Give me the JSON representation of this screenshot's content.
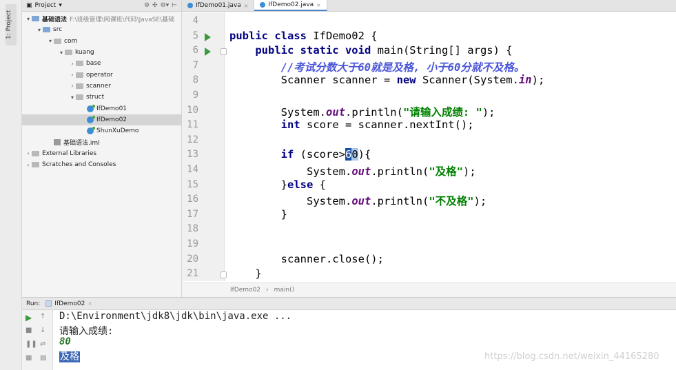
{
  "toolstrip": {
    "project_tab": "1: Project"
  },
  "project_panel": {
    "header_label": "Project",
    "header_icons": [
      "⚙",
      "✣",
      "⚙▾",
      "⊢"
    ],
    "tree": [
      {
        "label": "基础语法",
        "path": "F:\\班级管理\\网课班\\代码\\JavaSE\\基础",
        "indent": 0,
        "arrow": "▾",
        "icon": "folder-blue",
        "bold": true
      },
      {
        "label": "src",
        "indent": 1,
        "arrow": "▾",
        "icon": "folder-blue"
      },
      {
        "label": "com",
        "indent": 2,
        "arrow": "▾",
        "icon": "folder"
      },
      {
        "label": "kuang",
        "indent": 3,
        "arrow": "▾",
        "icon": "folder"
      },
      {
        "label": "base",
        "indent": 4,
        "arrow": "›",
        "icon": "folder"
      },
      {
        "label": "operator",
        "indent": 4,
        "arrow": "›",
        "icon": "folder"
      },
      {
        "label": "scanner",
        "indent": 4,
        "arrow": "›",
        "icon": "folder"
      },
      {
        "label": "struct",
        "indent": 4,
        "arrow": "▾",
        "icon": "folder"
      },
      {
        "label": "IfDemo01",
        "indent": 5,
        "arrow": "",
        "icon": "class"
      },
      {
        "label": "IfDemo02",
        "indent": 5,
        "arrow": "",
        "icon": "class",
        "selected": true
      },
      {
        "label": "ShunXuDemo",
        "indent": 5,
        "arrow": "",
        "icon": "class"
      },
      {
        "label": "基础语法.iml",
        "indent": 2,
        "arrow": "",
        "icon": "iml"
      },
      {
        "label": "External Libraries",
        "indent": 0,
        "arrow": "›",
        "icon": "folder"
      },
      {
        "label": "Scratches and Consoles",
        "indent": 0,
        "arrow": "›",
        "icon": "folder"
      }
    ]
  },
  "tabs": [
    {
      "label": "IfDemo01.java",
      "active": false
    },
    {
      "label": "IfDemo02.java",
      "active": true
    }
  ],
  "editor": {
    "lines": [
      {
        "num": "4",
        "html": ""
      },
      {
        "num": "5",
        "html": "<span class='kw'>public class</span> IfDemo02 {",
        "run": true
      },
      {
        "num": "6",
        "html": "    <span class='kw'>public static void</span> main(String[] args) {",
        "run": true,
        "fold": true
      },
      {
        "num": "7",
        "html": "        <span class='cmt'>//考试分数大于60就是及格, 小于60分就不及格。</span>"
      },
      {
        "num": "8",
        "html": "        Scanner scanner = <span class='kw'>new</span> Scanner(System.<span class='it'>in</span>);"
      },
      {
        "num": "9",
        "html": ""
      },
      {
        "num": "10",
        "html": "        System.<span class='it'>out</span>.println(<span class='str'>\"请输入成绩: \"</span>);"
      },
      {
        "num": "11",
        "html": "        <span class='kw'>int</span> score = scanner.nextInt();"
      },
      {
        "num": "12",
        "html": ""
      },
      {
        "num": "13",
        "html": "        <span class='kw'>if</span> (score><span class='caret-hl'>6</span><span class='caret-hl2'>0</span>){"
      },
      {
        "num": "14",
        "html": "            System.<span class='it'>out</span>.println(<span class='str'>\"及格\"</span>);"
      },
      {
        "num": "15",
        "html": "        }<span class='kw'>else</span> {"
      },
      {
        "num": "16",
        "html": "            System.<span class='it'>out</span>.println(<span class='str'>\"不及格\"</span>);"
      },
      {
        "num": "17",
        "html": "        }"
      },
      {
        "num": "18",
        "html": ""
      },
      {
        "num": "19",
        "html": ""
      },
      {
        "num": "20",
        "html": "        scanner.close();"
      },
      {
        "num": "21",
        "html": "    }",
        "fold": true
      }
    ]
  },
  "breadcrumb": {
    "class": "IfDemo02",
    "sep": "›",
    "method": "main()"
  },
  "run_panel": {
    "label": "Run:",
    "tab": "IfDemo02",
    "console": [
      {
        "text": "D:\\Environment\\jdk8\\jdk\\bin\\java.exe ...",
        "style": "cmd"
      },
      {
        "text": "请输入成绩:",
        "style": "cmd"
      },
      {
        "text": "80",
        "style": "input"
      },
      {
        "text": "及格",
        "style": "selected"
      }
    ]
  },
  "watermark": "https://blog.csdn.net/weixin_44165280"
}
